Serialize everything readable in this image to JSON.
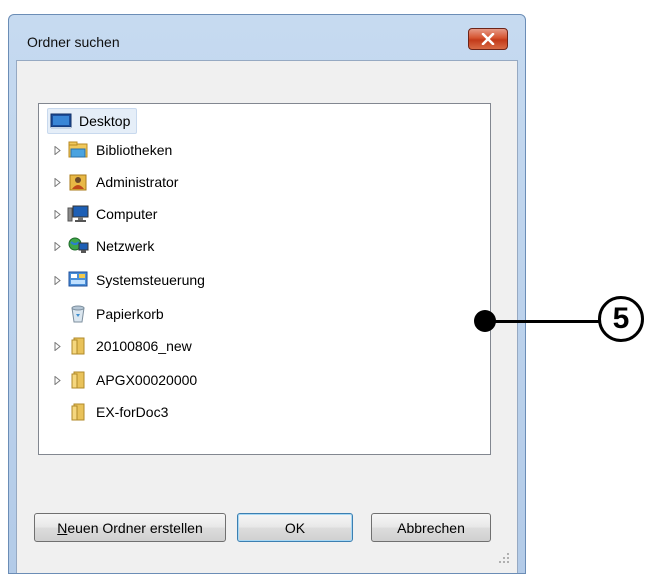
{
  "window": {
    "title": "Ordner suchen",
    "close_icon": "close-x-icon"
  },
  "tree": {
    "root": {
      "label": "Desktop",
      "icon": "desktop-icon"
    },
    "items": [
      {
        "label": "Bibliotheken",
        "icon": "libraries-icon",
        "expandable": true
      },
      {
        "label": "Administrator",
        "icon": "user-folder-icon",
        "expandable": true
      },
      {
        "label": "Computer",
        "icon": "computer-icon",
        "expandable": true
      },
      {
        "label": "Netzwerk",
        "icon": "network-icon",
        "expandable": true
      },
      {
        "label": "Systemsteuerung",
        "icon": "control-panel-icon",
        "expandable": true
      },
      {
        "label": "Papierkorb",
        "icon": "recycle-bin-icon",
        "expandable": false
      },
      {
        "label": "20100806_new",
        "icon": "folder-icon",
        "expandable": true
      },
      {
        "label": "APGX00020000",
        "icon": "folder-icon",
        "expandable": true
      },
      {
        "label": "EX-forDoc3",
        "icon": "folder-icon",
        "expandable": false
      }
    ]
  },
  "buttons": {
    "new_folder_accesskey": "N",
    "new_folder_rest": "euen Ordner erstellen",
    "ok": "OK",
    "cancel": "Abbrechen"
  },
  "callout": {
    "number": "5"
  },
  "colors": {
    "title_bar": "#c6daf0",
    "close_button": "#c33a1a",
    "selection": "#e5eef8"
  }
}
